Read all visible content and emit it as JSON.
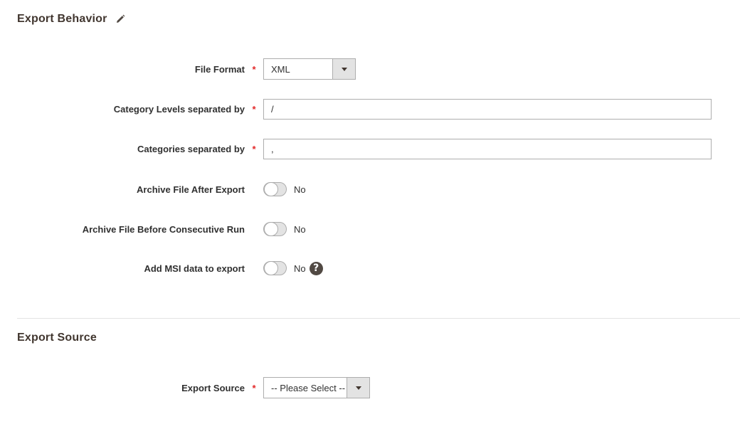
{
  "export_behavior": {
    "title": "Export Behavior",
    "edit_icon": "pencil-icon",
    "fields": {
      "file_format": {
        "label": "File Format",
        "required": "*",
        "value": "XML"
      },
      "category_levels": {
        "label": "Category Levels separated by",
        "required": "*",
        "value": "/"
      },
      "categories_separated": {
        "label": "Categories separated by",
        "required": "*",
        "value": ","
      },
      "archive_after": {
        "label": "Archive File After Export",
        "value": "No"
      },
      "archive_before": {
        "label": "Archive File Before Consecutive Run",
        "value": "No"
      },
      "add_msi": {
        "label": "Add MSI data to export",
        "value": "No",
        "help": "?"
      }
    }
  },
  "export_source": {
    "title": "Export Source",
    "fields": {
      "source": {
        "label": "Export Source",
        "required": "*",
        "value": "-- Please Select --"
      }
    }
  }
}
